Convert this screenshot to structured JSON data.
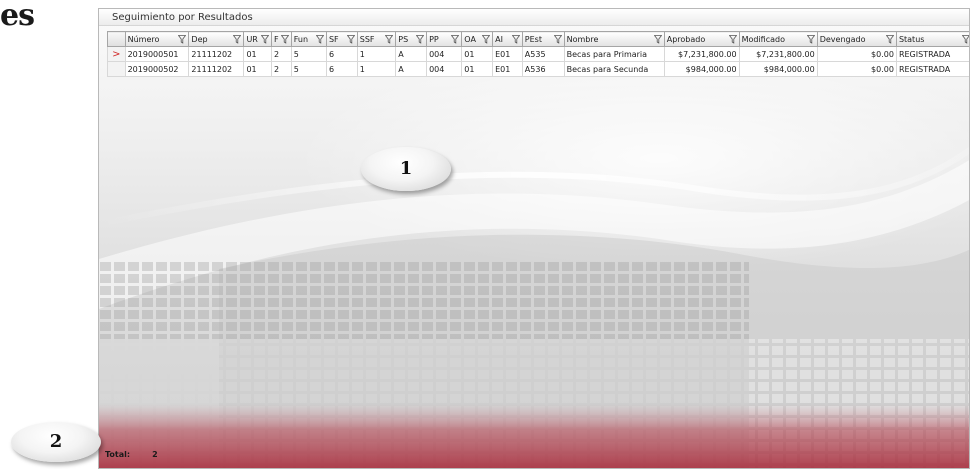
{
  "page": {
    "left_title": "es"
  },
  "window": {
    "title": "Seguimiento por Resultados"
  },
  "grid": {
    "columns": [
      "Número",
      "Dep",
      "UR",
      "F",
      "Fun",
      "SF",
      "SSF",
      "PS",
      "PP",
      "OA",
      "AI",
      "PEst",
      "Nombre",
      "Aprobado",
      "Modificado",
      "Devengado",
      "Status"
    ],
    "rows": [
      {
        "selected": true,
        "cells": [
          "2019000501",
          "21111202",
          "01",
          "2",
          "5",
          "6",
          "1",
          "A",
          "004",
          "01",
          "E01",
          "A535",
          "Becas para Primaria",
          "$7,231,800.00",
          "$7,231,800.00",
          "$0.00",
          "REGISTRADA"
        ]
      },
      {
        "selected": false,
        "cells": [
          "2019000502",
          "21111202",
          "01",
          "2",
          "5",
          "6",
          "1",
          "A",
          "004",
          "01",
          "E01",
          "A536",
          "Becas para Secunda",
          "$984,000.00",
          "$984,000.00",
          "$0.00",
          "REGISTRADA"
        ]
      }
    ],
    "row_pointer": ">"
  },
  "footer": {
    "total_label": "Total:",
    "total_value": "2"
  },
  "callouts": {
    "one": "1",
    "two": "2"
  },
  "icons": {
    "filter": "filter-icon",
    "row_pointer": "row-pointer-icon"
  },
  "colors": {
    "pointer": "#d12a2a",
    "footer_band": "#b23a48"
  }
}
